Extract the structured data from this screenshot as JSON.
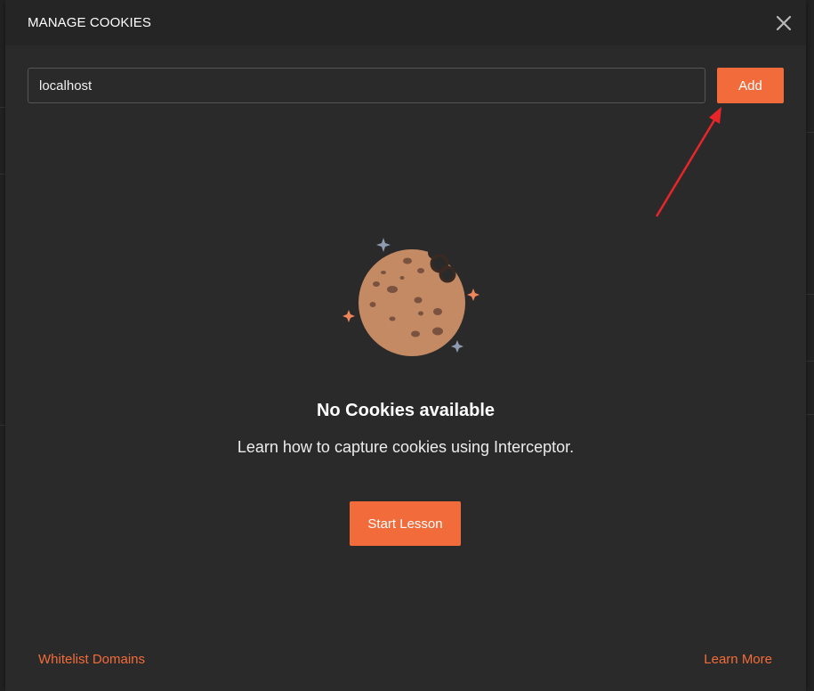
{
  "modal": {
    "title": "MANAGE COOKIES",
    "close_icon": "close-icon"
  },
  "domain_input": {
    "value": "localhost"
  },
  "add_button": {
    "label": "Add"
  },
  "empty_state": {
    "illustration_icon": "cookie-icon",
    "title": "No Cookies available",
    "description": "Learn how to capture cookies using Interceptor.",
    "button_label": "Start Lesson"
  },
  "footer": {
    "whitelist_label": "Whitelist Domains",
    "learn_more_label": "Learn More"
  },
  "annotation": {
    "type": "arrow",
    "color": "#e8262a",
    "points_to": "add-button"
  },
  "colors": {
    "accent": "#f26b3a",
    "modal_bg": "#2b2a2a",
    "header_bg": "#262525",
    "text": "#ffffff",
    "input_border": "#555555"
  }
}
